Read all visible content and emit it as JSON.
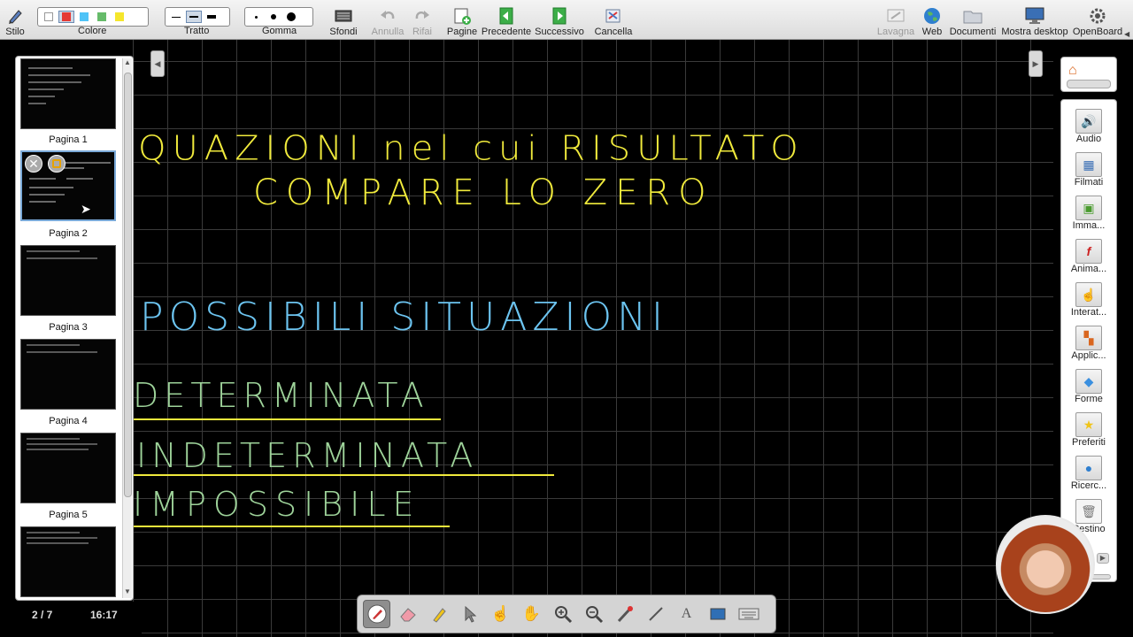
{
  "toolbar": {
    "stylus_label": "Stilo",
    "color_label": "Colore",
    "stroke_label": "Tratto",
    "eraser_label": "Gomma",
    "backgrounds_label": "Sfondi",
    "undo_label": "Annulla",
    "redo_label": "Rifai",
    "pages_label": "Pagine",
    "previous_label": "Precedente",
    "next_label": "Successivo",
    "clear_label": "Cancella",
    "board_label": "Lavagna",
    "web_label": "Web",
    "documents_label": "Documenti",
    "desktop_label": "Mostra desktop",
    "openboard_label": "OpenBoard",
    "colors": [
      "#ffffff",
      "#e53935",
      "#4fc3f7",
      "#66bb6a",
      "#f5e62c"
    ]
  },
  "pages": {
    "items": [
      {
        "label": "Pagina 1"
      },
      {
        "label": "Pagina 2"
      },
      {
        "label": "Pagina 3"
      },
      {
        "label": "Pagina 4"
      },
      {
        "label": "Pagina 5"
      }
    ],
    "counter": "2 / 7",
    "time": "16:17"
  },
  "board": {
    "title_line1": "QUAZIONI nel cui RISULTATO",
    "title_line2": "COMPARE LO ZERO",
    "heading": "POSSIBILI   SITUAZIONI",
    "item1": "DETERMINATA",
    "item2": "INDETERMINATA",
    "item3": "IMPOSSIBILE",
    "yellow": "#f0ea3c",
    "blue": "#6cc4f0",
    "green": "#9ed39a"
  },
  "library": {
    "items": [
      {
        "label": "Audio"
      },
      {
        "label": "Filmati"
      },
      {
        "label": "Imma..."
      },
      {
        "label": "Anima..."
      },
      {
        "label": "Interat..."
      },
      {
        "label": "Applic..."
      },
      {
        "label": "Forme"
      },
      {
        "label": "Preferiti"
      },
      {
        "label": "Ricerc..."
      },
      {
        "label": "Cestino"
      }
    ]
  }
}
